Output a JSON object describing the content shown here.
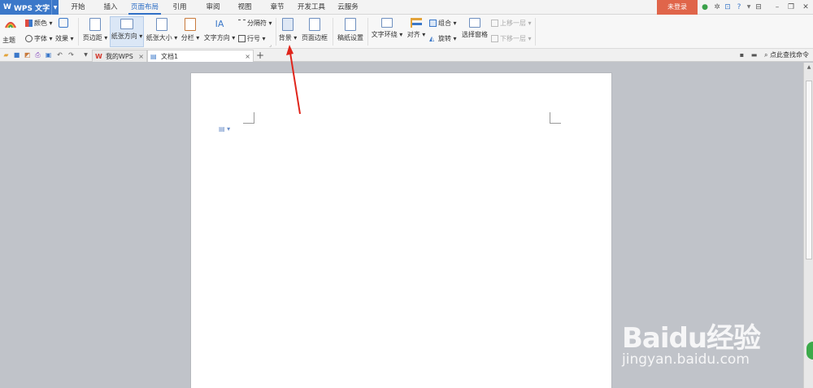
{
  "app": {
    "name": "WPS 文字",
    "logo": "W"
  },
  "menu": {
    "tabs": [
      {
        "label": "开始",
        "active": false
      },
      {
        "label": "插入",
        "active": false
      },
      {
        "label": "页面布局",
        "active": true
      },
      {
        "label": "引用",
        "active": false
      },
      {
        "label": "审阅",
        "active": false
      },
      {
        "label": "视图",
        "active": false
      },
      {
        "label": "章节",
        "active": false
      },
      {
        "label": "开发工具",
        "active": false
      },
      {
        "label": "云服务",
        "active": false
      }
    ],
    "login_label": "未登录"
  },
  "ribbon": {
    "theme": "主题",
    "color": "颜色",
    "font": "字体",
    "effect": "效果",
    "margins": "页边距",
    "orientation": "纸张方向",
    "paper_size": "纸张大小",
    "columns": "分栏",
    "text_direction": "文字方向",
    "separator": "分隔符",
    "line_numbers": "行号",
    "background": "背景",
    "page_border": "页面边框",
    "manuscript_setup": "稿纸设置",
    "text_wrap": "文字环绕",
    "align": "对齐",
    "group": "组合",
    "rotate": "旋转",
    "selection_pane": "选择窗格",
    "bring_forward": "上移一层",
    "send_backward": "下移一层"
  },
  "tabs_bar": {
    "documents": [
      {
        "label": "我的WPS",
        "active": false
      },
      {
        "label": "文档1",
        "active": true
      }
    ],
    "add_label": "+",
    "search_command": "点此查找命令"
  },
  "watermark": {
    "brand": "Baidu经验",
    "url": "jingyan.baidu.com"
  },
  "colors": {
    "accent": "#2f6fc5",
    "app_button": "#3b78c9",
    "login_button": "#e0654a",
    "workspace": "#c0c3c9"
  }
}
